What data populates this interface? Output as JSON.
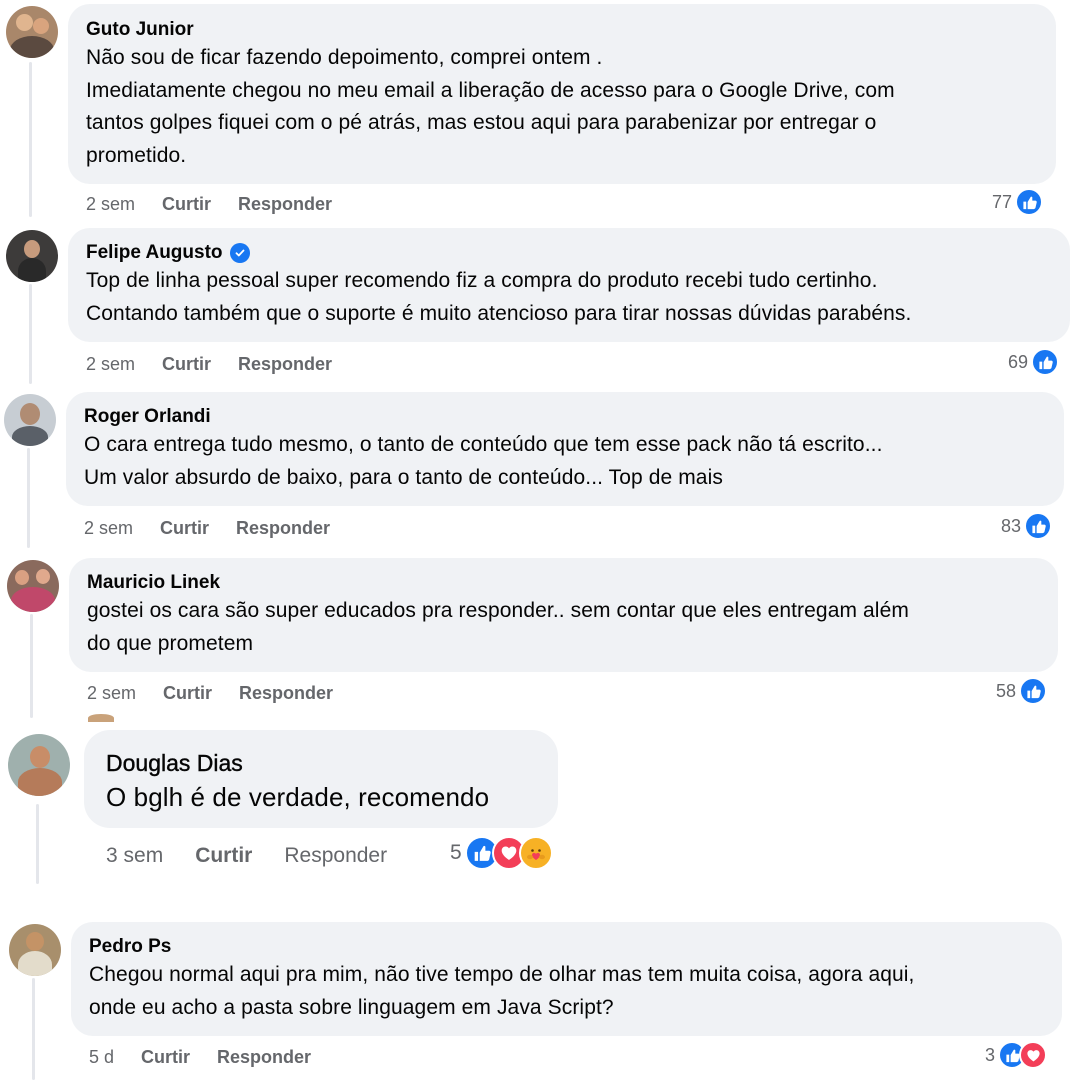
{
  "comments": [
    {
      "name": "Guto Junior",
      "text_lines": [
        "Não sou de ficar fazendo depoimento, comprei ontem .",
        "Imediatamente chegou no meu email a liberação de acesso para o Google Drive, com",
        "tantos golpes fiquei com o pé atrás, mas estou aqui para parabenizar por entregar o",
        "prometido."
      ],
      "time": "2 sem",
      "like_label": "Curtir",
      "reply_label": "Responder",
      "reaction_count": "77",
      "reactions": [
        "like-icon"
      ],
      "verified": false
    },
    {
      "name": "Felipe Augusto",
      "text_lines": [
        "Top de linha pessoal super recomendo fiz a compra do produto recebi tudo certinho.",
        "Contando também que o suporte é muito atencioso para tirar nossas dúvidas parabéns."
      ],
      "time": "2 sem",
      "like_label": "Curtir",
      "reply_label": "Responder",
      "reaction_count": "69",
      "reactions": [
        "like-icon"
      ],
      "verified": true
    },
    {
      "name": "Roger Orlandi",
      "text_lines": [
        "O cara entrega tudo mesmo, o tanto de conteúdo que tem esse pack não tá escrito...",
        "Um valor absurdo de baixo, para o tanto de conteúdo... Top de mais"
      ],
      "time": "2 sem",
      "like_label": "Curtir",
      "reply_label": "Responder",
      "reaction_count": "83",
      "reactions": [
        "like-icon"
      ],
      "verified": false
    },
    {
      "name": "Mauricio Linek",
      "text_lines": [
        "gostei os cara são super educados pra responder.. sem contar que eles entregam além",
        "do que prometem"
      ],
      "time": "2 sem",
      "like_label": "Curtir",
      "reply_label": "Responder",
      "reaction_count": "58",
      "reactions": [
        "like-icon"
      ],
      "verified": false
    },
    {
      "name": "Douglas Dias",
      "text_lines": [
        "O bglh é de verdade, recomendo"
      ],
      "time": "3 sem",
      "like_label": "Curtir",
      "reply_label": "Responder",
      "reaction_count": "5",
      "reactions": [
        "like-icon",
        "love-icon",
        "care-icon"
      ],
      "verified": false
    },
    {
      "name": "Pedro Ps",
      "text_lines": [
        "Chegou normal aqui pra mim, não tive tempo de olhar mas tem muita coisa, agora aqui,",
        "onde eu acho a pasta sobre linguagem em Java Script?"
      ],
      "time": "5 d",
      "like_label": "Curtir",
      "reply_label": "Responder",
      "reaction_count": "3",
      "reactions": [
        "like-icon",
        "love-icon"
      ],
      "verified": false
    }
  ],
  "colors": {
    "bubble": "#f0f2f5",
    "meta_text": "#65676b",
    "like": "#1877f2",
    "love": "#f33e58",
    "care": "#f7b125",
    "thread_line": "#e4e6eb"
  }
}
